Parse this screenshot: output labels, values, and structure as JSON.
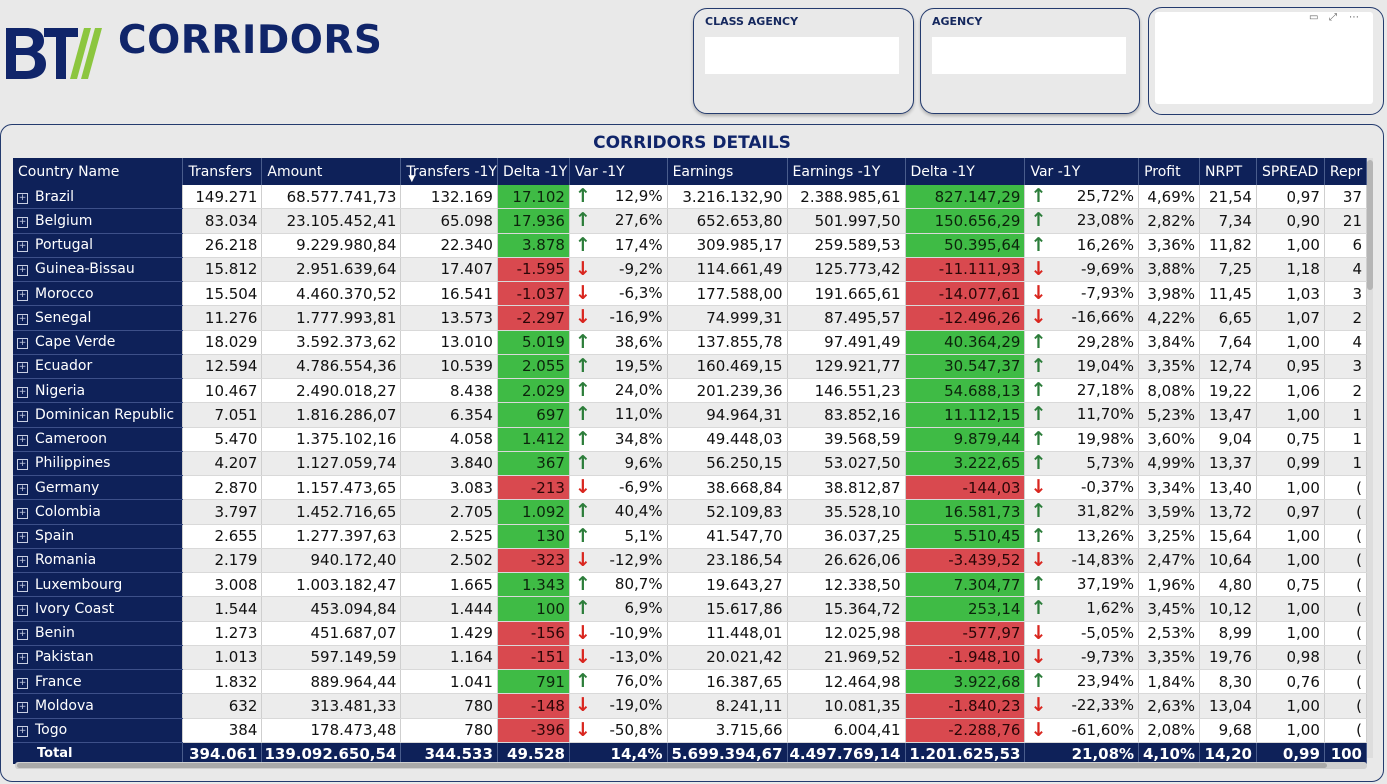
{
  "header": {
    "app_title": "CORRIDORS"
  },
  "slicers": [
    {
      "title": "CLASS AGENCY",
      "value": ""
    },
    {
      "title": "AGENCY",
      "value": ""
    }
  ],
  "panel": {
    "title": "CORRIDORS DETAILS"
  },
  "colors": {
    "navy": "#0e2159",
    "positive": "#3fbb45",
    "negative": "#d9494f",
    "arrow_up": "#2c7d3a",
    "arrow_down": "#d9261f"
  },
  "icons": {
    "up": "arrow-up-icon",
    "down": "arrow-down-icon",
    "expand": "expand-plus-icon",
    "sort": "sort-descending-icon"
  },
  "table": {
    "columns": [
      "Country Name",
      "Transfers",
      "Amount",
      "Transfers -1Y",
      "Delta -1Y",
      "Var -1Y",
      "Earnings",
      "Earnings -1Y",
      "Delta -1Y",
      "Var -1Y",
      "Profit",
      "NRPT",
      "SPREAD",
      "Repr"
    ],
    "rows": [
      {
        "country": "Brazil",
        "transfers": "149.271",
        "amount": "68.577.741,73",
        "transfers_1y": "132.169",
        "delta_1y": "17.102",
        "var_1y": "12,9%",
        "earnings": "3.216.132,90",
        "earnings_1y": "2.388.985,61",
        "edelta_1y": "827.147,29",
        "evar_1y": "25,72%",
        "profit": "4,69%",
        "nrpt": "21,54",
        "spread": "0,97",
        "repr": "37",
        "dir": "up"
      },
      {
        "country": "Belgium",
        "transfers": "83.034",
        "amount": "23.105.452,41",
        "transfers_1y": "65.098",
        "delta_1y": "17.936",
        "var_1y": "27,6%",
        "earnings": "652.653,80",
        "earnings_1y": "501.997,50",
        "edelta_1y": "150.656,29",
        "evar_1y": "23,08%",
        "profit": "2,82%",
        "nrpt": "7,34",
        "spread": "0,90",
        "repr": "21",
        "dir": "up"
      },
      {
        "country": "Portugal",
        "transfers": "26.218",
        "amount": "9.229.980,84",
        "transfers_1y": "22.340",
        "delta_1y": "3.878",
        "var_1y": "17,4%",
        "earnings": "309.985,17",
        "earnings_1y": "259.589,53",
        "edelta_1y": "50.395,64",
        "evar_1y": "16,26%",
        "profit": "3,36%",
        "nrpt": "11,82",
        "spread": "1,00",
        "repr": "6",
        "dir": "up"
      },
      {
        "country": "Guinea-Bissau",
        "transfers": "15.812",
        "amount": "2.951.639,64",
        "transfers_1y": "17.407",
        "delta_1y": "-1.595",
        "var_1y": "-9,2%",
        "earnings": "114.661,49",
        "earnings_1y": "125.773,42",
        "edelta_1y": "-11.111,93",
        "evar_1y": "-9,69%",
        "profit": "3,88%",
        "nrpt": "7,25",
        "spread": "1,18",
        "repr": "4",
        "dir": "down"
      },
      {
        "country": "Morocco",
        "transfers": "15.504",
        "amount": "4.460.370,52",
        "transfers_1y": "16.541",
        "delta_1y": "-1.037",
        "var_1y": "-6,3%",
        "earnings": "177.588,00",
        "earnings_1y": "191.665,61",
        "edelta_1y": "-14.077,61",
        "evar_1y": "-7,93%",
        "profit": "3,98%",
        "nrpt": "11,45",
        "spread": "1,03",
        "repr": "3",
        "dir": "down"
      },
      {
        "country": "Senegal",
        "transfers": "11.276",
        "amount": "1.777.993,81",
        "transfers_1y": "13.573",
        "delta_1y": "-2.297",
        "var_1y": "-16,9%",
        "earnings": "74.999,31",
        "earnings_1y": "87.495,57",
        "edelta_1y": "-12.496,26",
        "evar_1y": "-16,66%",
        "profit": "4,22%",
        "nrpt": "6,65",
        "spread": "1,07",
        "repr": "2",
        "dir": "down"
      },
      {
        "country": "Cape Verde",
        "transfers": "18.029",
        "amount": "3.592.373,62",
        "transfers_1y": "13.010",
        "delta_1y": "5.019",
        "var_1y": "38,6%",
        "earnings": "137.855,78",
        "earnings_1y": "97.491,49",
        "edelta_1y": "40.364,29",
        "evar_1y": "29,28%",
        "profit": "3,84%",
        "nrpt": "7,64",
        "spread": "1,00",
        "repr": "4",
        "dir": "up"
      },
      {
        "country": "Ecuador",
        "transfers": "12.594",
        "amount": "4.786.554,36",
        "transfers_1y": "10.539",
        "delta_1y": "2.055",
        "var_1y": "19,5%",
        "earnings": "160.469,15",
        "earnings_1y": "129.921,77",
        "edelta_1y": "30.547,37",
        "evar_1y": "19,04%",
        "profit": "3,35%",
        "nrpt": "12,74",
        "spread": "0,95",
        "repr": "3",
        "dir": "up"
      },
      {
        "country": "Nigeria",
        "transfers": "10.467",
        "amount": "2.490.018,27",
        "transfers_1y": "8.438",
        "delta_1y": "2.029",
        "var_1y": "24,0%",
        "earnings": "201.239,36",
        "earnings_1y": "146.551,23",
        "edelta_1y": "54.688,13",
        "evar_1y": "27,18%",
        "profit": "8,08%",
        "nrpt": "19,22",
        "spread": "1,06",
        "repr": "2",
        "dir": "up"
      },
      {
        "country": "Dominican Republic",
        "transfers": "7.051",
        "amount": "1.816.286,07",
        "transfers_1y": "6.354",
        "delta_1y": "697",
        "var_1y": "11,0%",
        "earnings": "94.964,31",
        "earnings_1y": "83.852,16",
        "edelta_1y": "11.112,15",
        "evar_1y": "11,70%",
        "profit": "5,23%",
        "nrpt": "13,47",
        "spread": "1,00",
        "repr": "1",
        "dir": "up"
      },
      {
        "country": "Cameroon",
        "transfers": "5.470",
        "amount": "1.375.102,16",
        "transfers_1y": "4.058",
        "delta_1y": "1.412",
        "var_1y": "34,8%",
        "earnings": "49.448,03",
        "earnings_1y": "39.568,59",
        "edelta_1y": "9.879,44",
        "evar_1y": "19,98%",
        "profit": "3,60%",
        "nrpt": "9,04",
        "spread": "0,75",
        "repr": "1",
        "dir": "up"
      },
      {
        "country": "Philippines",
        "transfers": "4.207",
        "amount": "1.127.059,74",
        "transfers_1y": "3.840",
        "delta_1y": "367",
        "var_1y": "9,6%",
        "earnings": "56.250,15",
        "earnings_1y": "53.027,50",
        "edelta_1y": "3.222,65",
        "evar_1y": "5,73%",
        "profit": "4,99%",
        "nrpt": "13,37",
        "spread": "0,99",
        "repr": "1",
        "dir": "up"
      },
      {
        "country": "Germany",
        "transfers": "2.870",
        "amount": "1.157.473,65",
        "transfers_1y": "3.083",
        "delta_1y": "-213",
        "var_1y": "-6,9%",
        "earnings": "38.668,84",
        "earnings_1y": "38.812,87",
        "edelta_1y": "-144,03",
        "evar_1y": "-0,37%",
        "profit": "3,34%",
        "nrpt": "13,40",
        "spread": "1,00",
        "repr": "(",
        "dir": "down"
      },
      {
        "country": "Colombia",
        "transfers": "3.797",
        "amount": "1.452.716,65",
        "transfers_1y": "2.705",
        "delta_1y": "1.092",
        "var_1y": "40,4%",
        "earnings": "52.109,83",
        "earnings_1y": "35.528,10",
        "edelta_1y": "16.581,73",
        "evar_1y": "31,82%",
        "profit": "3,59%",
        "nrpt": "13,72",
        "spread": "0,97",
        "repr": "(",
        "dir": "up"
      },
      {
        "country": "Spain",
        "transfers": "2.655",
        "amount": "1.277.397,63",
        "transfers_1y": "2.525",
        "delta_1y": "130",
        "var_1y": "5,1%",
        "earnings": "41.547,70",
        "earnings_1y": "36.037,25",
        "edelta_1y": "5.510,45",
        "evar_1y": "13,26%",
        "profit": "3,25%",
        "nrpt": "15,64",
        "spread": "1,00",
        "repr": "(",
        "dir": "up"
      },
      {
        "country": "Romania",
        "transfers": "2.179",
        "amount": "940.172,40",
        "transfers_1y": "2.502",
        "delta_1y": "-323",
        "var_1y": "-12,9%",
        "earnings": "23.186,54",
        "earnings_1y": "26.626,06",
        "edelta_1y": "-3.439,52",
        "evar_1y": "-14,83%",
        "profit": "2,47%",
        "nrpt": "10,64",
        "spread": "1,00",
        "repr": "(",
        "dir": "down"
      },
      {
        "country": "Luxembourg",
        "transfers": "3.008",
        "amount": "1.003.182,47",
        "transfers_1y": "1.665",
        "delta_1y": "1.343",
        "var_1y": "80,7%",
        "earnings": "19.643,27",
        "earnings_1y": "12.338,50",
        "edelta_1y": "7.304,77",
        "evar_1y": "37,19%",
        "profit": "1,96%",
        "nrpt": "4,80",
        "spread": "0,75",
        "repr": "(",
        "dir": "up"
      },
      {
        "country": "Ivory Coast",
        "transfers": "1.544",
        "amount": "453.094,84",
        "transfers_1y": "1.444",
        "delta_1y": "100",
        "var_1y": "6,9%",
        "earnings": "15.617,86",
        "earnings_1y": "15.364,72",
        "edelta_1y": "253,14",
        "evar_1y": "1,62%",
        "profit": "3,45%",
        "nrpt": "10,12",
        "spread": "1,00",
        "repr": "(",
        "dir": "up"
      },
      {
        "country": "Benin",
        "transfers": "1.273",
        "amount": "451.687,07",
        "transfers_1y": "1.429",
        "delta_1y": "-156",
        "var_1y": "-10,9%",
        "earnings": "11.448,01",
        "earnings_1y": "12.025,98",
        "edelta_1y": "-577,97",
        "evar_1y": "-5,05%",
        "profit": "2,53%",
        "nrpt": "8,99",
        "spread": "1,00",
        "repr": "(",
        "dir": "down"
      },
      {
        "country": "Pakistan",
        "transfers": "1.013",
        "amount": "597.149,59",
        "transfers_1y": "1.164",
        "delta_1y": "-151",
        "var_1y": "-13,0%",
        "earnings": "20.021,42",
        "earnings_1y": "21.969,52",
        "edelta_1y": "-1.948,10",
        "evar_1y": "-9,73%",
        "profit": "3,35%",
        "nrpt": "19,76",
        "spread": "0,98",
        "repr": "(",
        "dir": "down"
      },
      {
        "country": "France",
        "transfers": "1.832",
        "amount": "889.964,44",
        "transfers_1y": "1.041",
        "delta_1y": "791",
        "var_1y": "76,0%",
        "earnings": "16.387,65",
        "earnings_1y": "12.464,98",
        "edelta_1y": "3.922,68",
        "evar_1y": "23,94%",
        "profit": "1,84%",
        "nrpt": "8,30",
        "spread": "0,76",
        "repr": "(",
        "dir": "up"
      },
      {
        "country": "Moldova",
        "transfers": "632",
        "amount": "313.481,33",
        "transfers_1y": "780",
        "delta_1y": "-148",
        "var_1y": "-19,0%",
        "earnings": "8.241,11",
        "earnings_1y": "10.081,35",
        "edelta_1y": "-1.840,23",
        "evar_1y": "-22,33%",
        "profit": "2,63%",
        "nrpt": "13,04",
        "spread": "1,00",
        "repr": "(",
        "dir": "down"
      },
      {
        "country": "Togo",
        "transfers": "384",
        "amount": "178.473,48",
        "transfers_1y": "780",
        "delta_1y": "-396",
        "var_1y": "-50,8%",
        "earnings": "3.715,66",
        "earnings_1y": "6.004,41",
        "edelta_1y": "-2.288,76",
        "evar_1y": "-61,60%",
        "profit": "2,08%",
        "nrpt": "9,68",
        "spread": "1,00",
        "repr": "(",
        "dir": "down"
      }
    ],
    "total": {
      "label": "Total",
      "transfers": "394.061",
      "amount": "139.092.650,54",
      "transfers_1y": "344.533",
      "delta_1y": "49.528",
      "var_1y": "14,4%",
      "earnings": "5.699.394,67",
      "earnings_1y": "4.497.769,14",
      "edelta_1y": "1.201.625,53",
      "evar_1y": "21,08%",
      "profit": "4,10%",
      "nrpt": "14,20",
      "spread": "0,99",
      "repr": "100"
    }
  }
}
